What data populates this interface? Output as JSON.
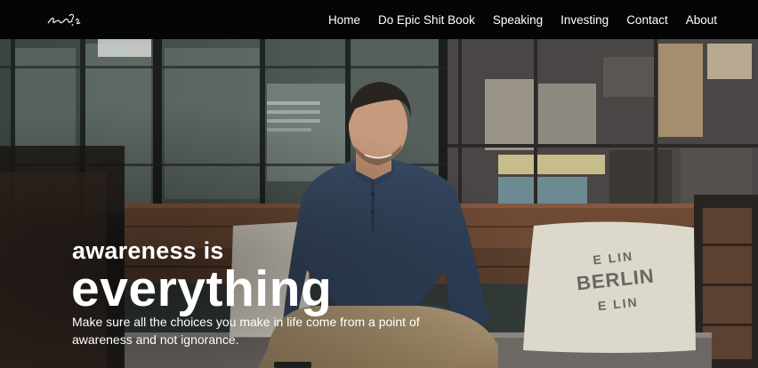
{
  "nav": {
    "items": [
      {
        "label": "Home"
      },
      {
        "label": "Do Epic Shit Book"
      },
      {
        "label": "Speaking"
      },
      {
        "label": "Investing"
      },
      {
        "label": "Contact"
      },
      {
        "label": "About"
      }
    ]
  },
  "hero": {
    "headline_top": "awareness is",
    "headline_main": "everything",
    "subtext": "Make sure all the choices you make in life come from a point of awareness and not ignorance."
  },
  "pillow": {
    "line1": "E  LIN",
    "line2": "BERLIN",
    "line3": "E  LIN"
  },
  "colors": {
    "nav_bg": "#050505",
    "text": "#ffffff"
  }
}
